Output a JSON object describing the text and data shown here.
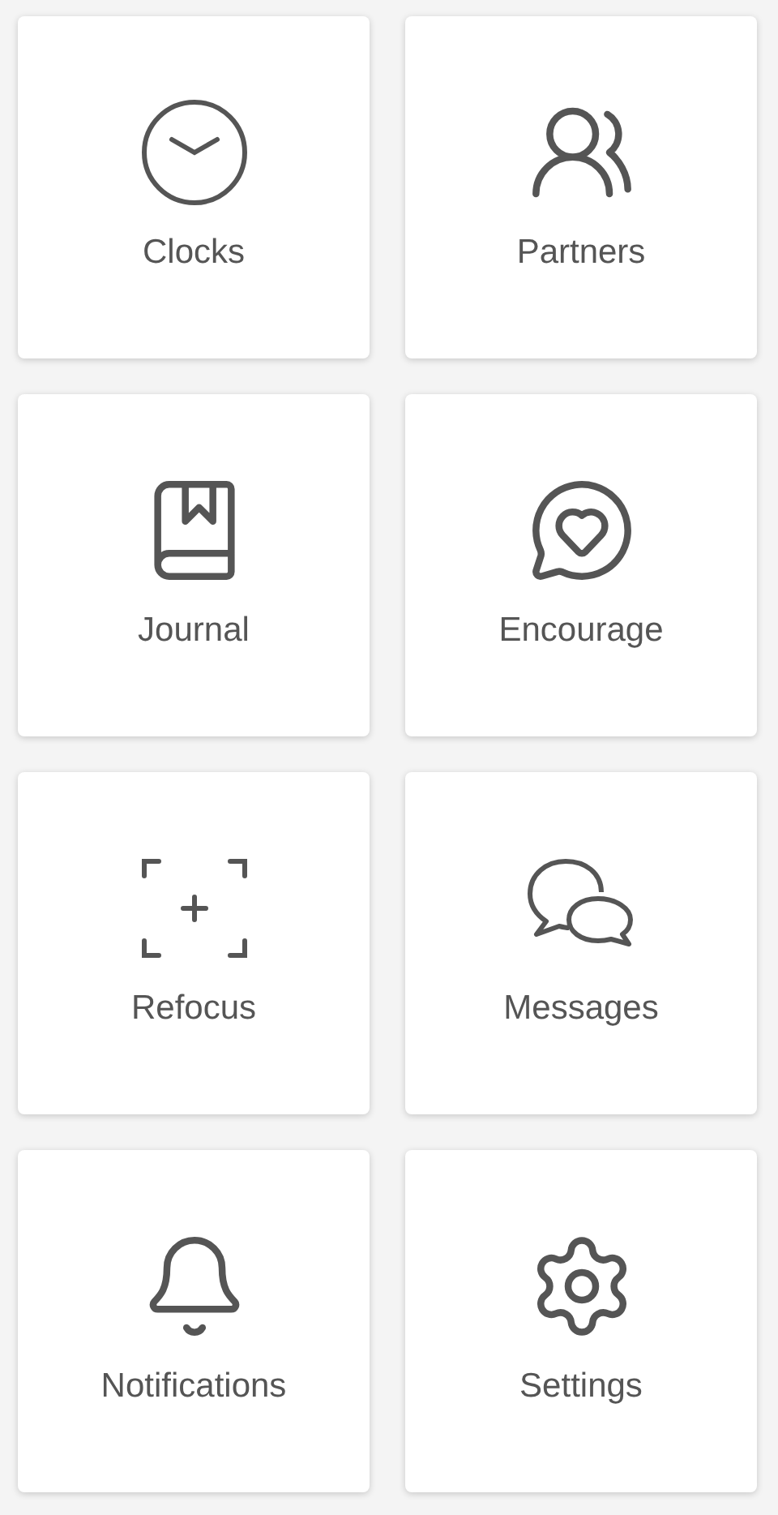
{
  "tiles": [
    {
      "kind": "clock",
      "label": "Clocks"
    },
    {
      "kind": "people",
      "label": "Partners"
    },
    {
      "kind": "book",
      "label": "Journal"
    },
    {
      "kind": "heart-bubble",
      "label": "Encourage"
    },
    {
      "kind": "focus",
      "label": "Refocus"
    },
    {
      "kind": "chats",
      "label": "Messages"
    },
    {
      "kind": "bell",
      "label": "Notifications"
    },
    {
      "kind": "gear",
      "label": "Settings"
    }
  ]
}
